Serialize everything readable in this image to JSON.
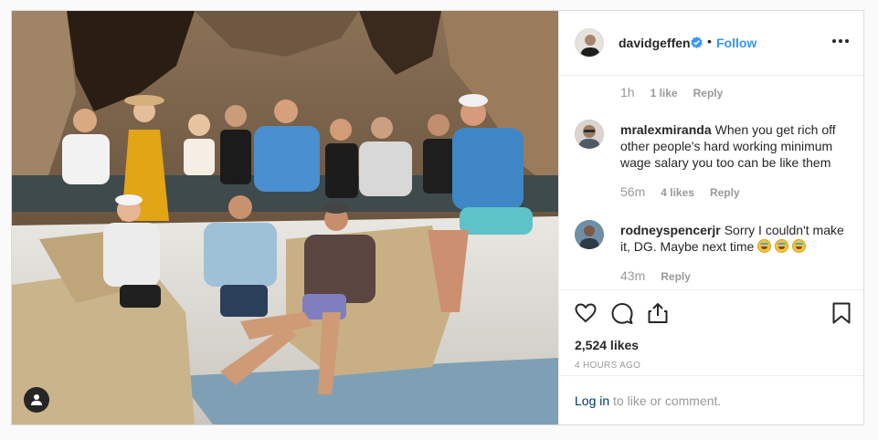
{
  "post": {
    "author": {
      "username": "davidgeffen",
      "verified_icon": "verified-badge-icon",
      "separator": "•",
      "follow_label": "Follow"
    },
    "more_icon": "more-options-icon"
  },
  "comments": {
    "first_meta": {
      "time": "1h",
      "likes": "1 like",
      "reply": "Reply"
    },
    "items": [
      {
        "author": "mralexmiranda",
        "text": "When you get rich off other people's hard working minimum wage salary you too can be like them",
        "time": "56m",
        "likes": "4 likes",
        "reply": "Reply"
      },
      {
        "author": "rodneyspencerjr",
        "text": "Sorry I couldn't make it, DG. Maybe next time",
        "emojis": [
          "face-with-tears-of-joy-icon",
          "face-with-tears-of-joy-icon",
          "face-with-tears-of-joy-icon"
        ],
        "time": "43m",
        "reply": "Reply"
      }
    ]
  },
  "actions": {
    "icons": [
      "heart-icon",
      "comment-icon",
      "share-icon",
      "bookmark-icon"
    ],
    "likes_count": "2,524 likes",
    "timestamp": "4 HOURS AGO"
  },
  "login_prompt": {
    "link": "Log in",
    "rest": " to like or comment."
  },
  "colors": {
    "link_blue": "#3897f0",
    "login_link": "#003569",
    "muted": "#999999",
    "text": "#262626",
    "border": "#dbdbdb"
  }
}
